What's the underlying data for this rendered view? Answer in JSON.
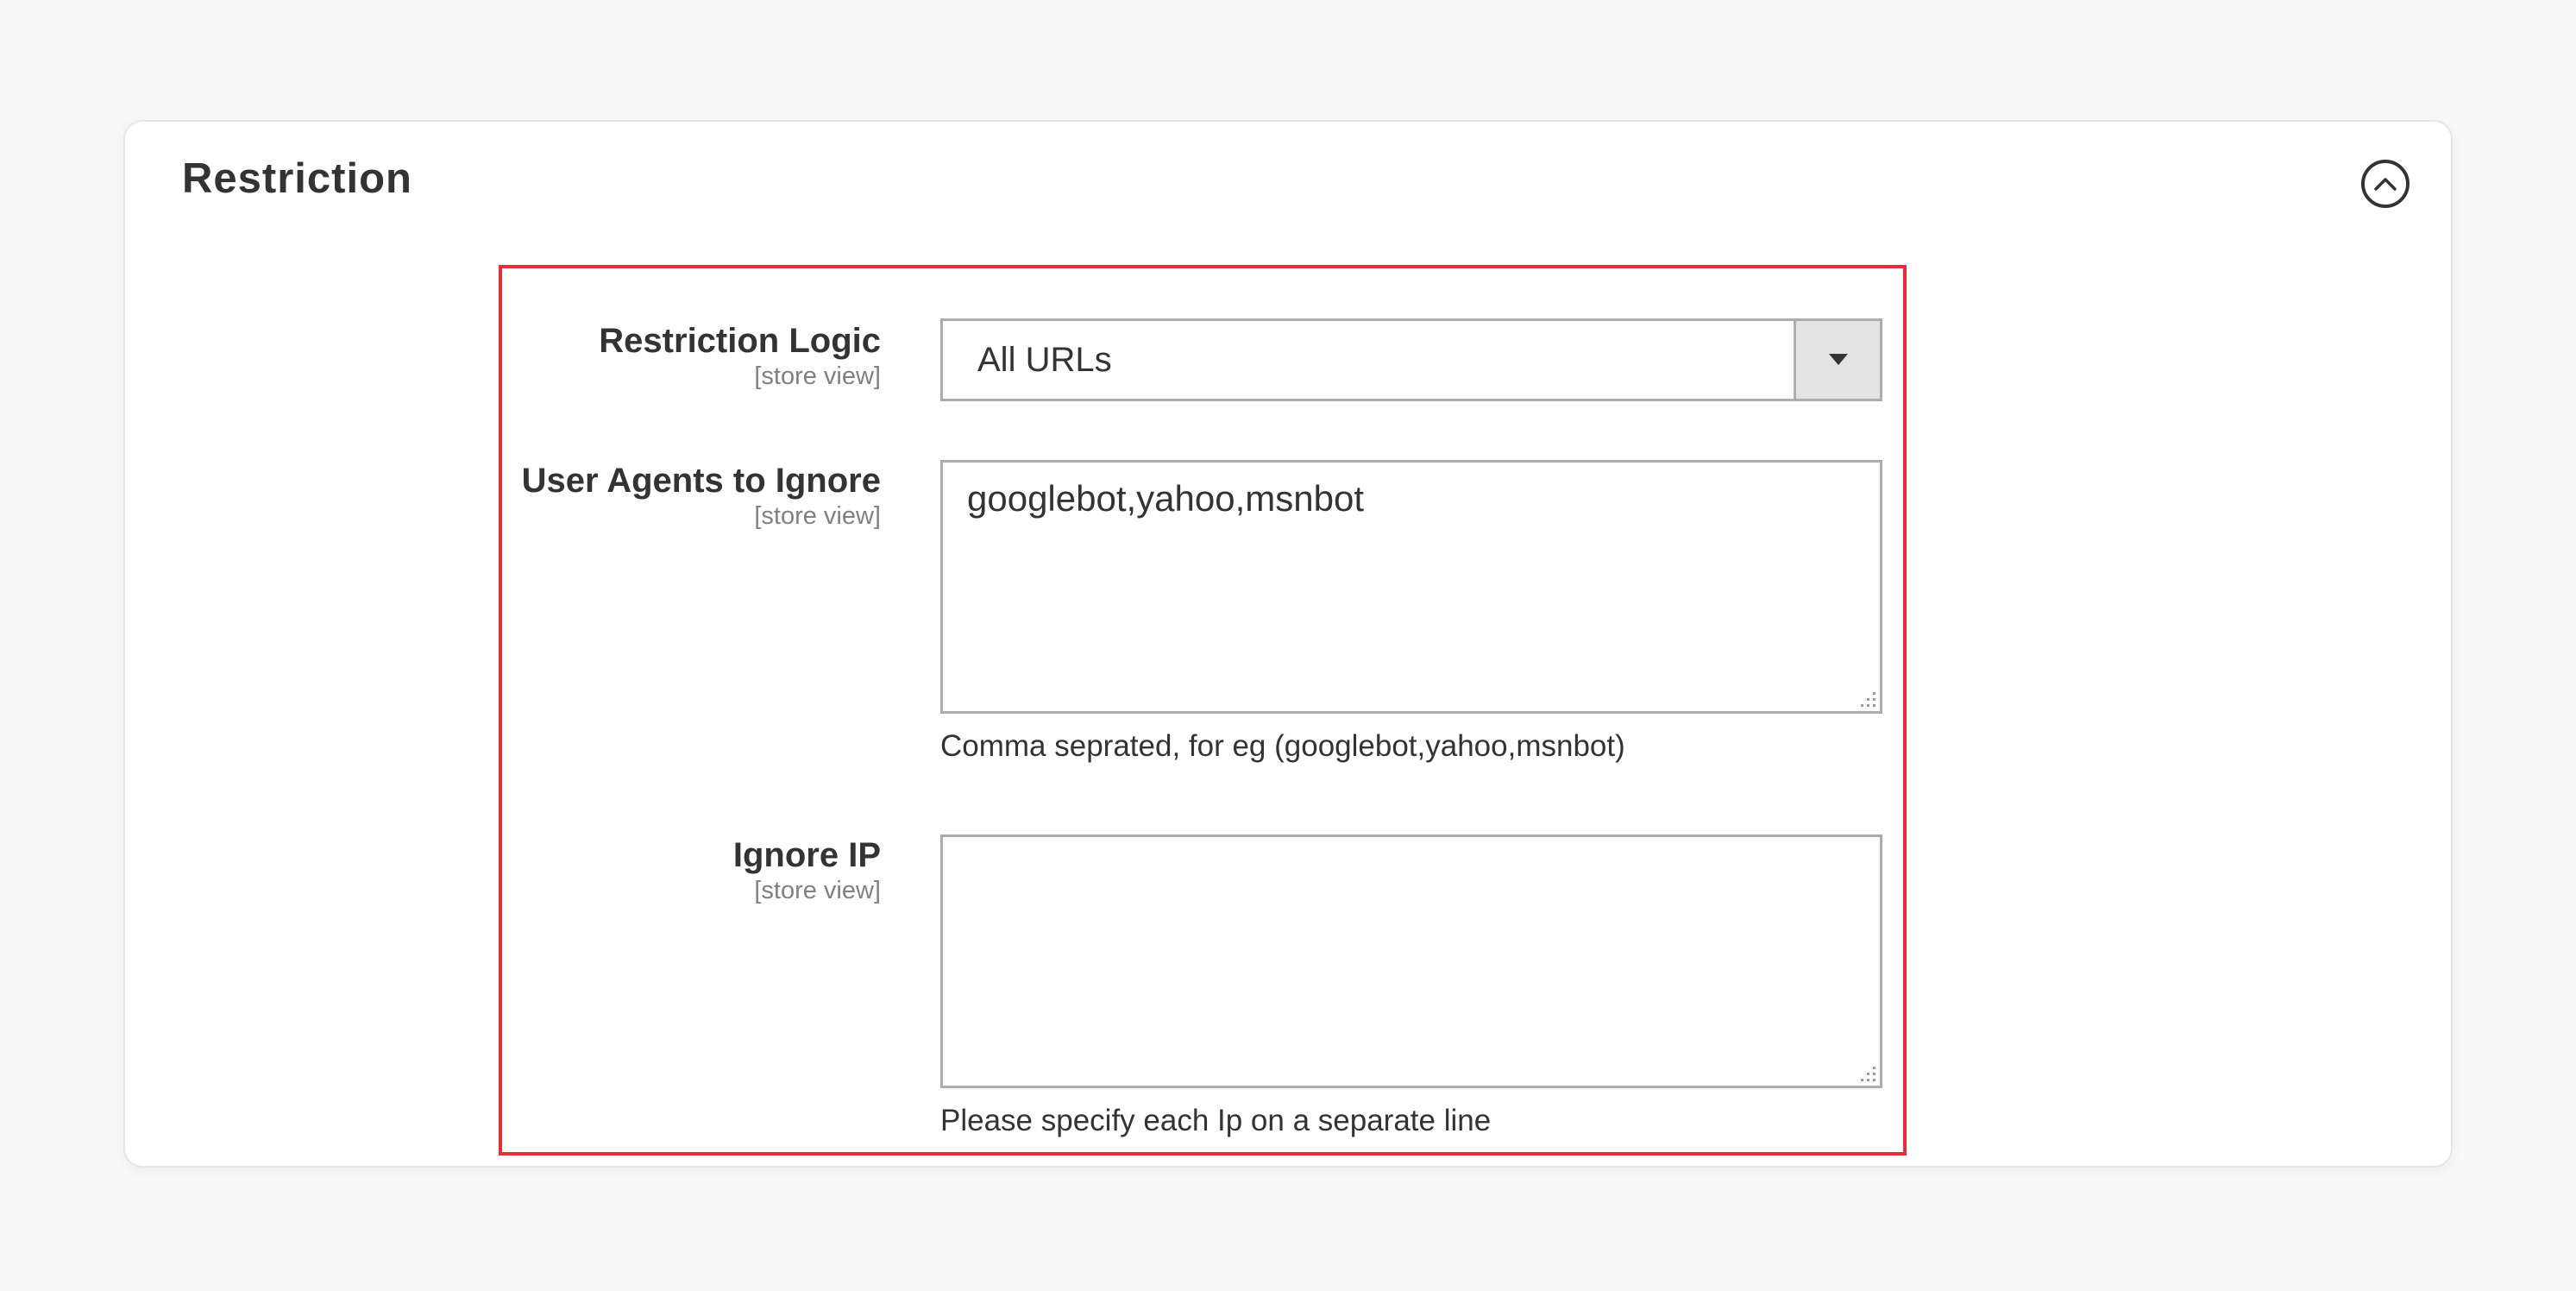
{
  "section": {
    "title": "Restriction",
    "collapse_icon": "chevron-up-circle-icon"
  },
  "highlight_color": "#e0313b",
  "fields": {
    "restriction_logic": {
      "label": "Restriction Logic",
      "scope": "[store view]",
      "value": "All URLs",
      "icon": "triangle-down-icon"
    },
    "user_agents": {
      "label": "User Agents to Ignore",
      "scope": "[store view]",
      "value": "googlebot,yahoo,msnbot",
      "note": "Comma seprated, for eg (googlebot,yahoo,msnbot)"
    },
    "ignore_ip": {
      "label": "Ignore IP",
      "scope": "[store view]",
      "value": "",
      "note": "Please specify each Ip on a separate line"
    }
  }
}
